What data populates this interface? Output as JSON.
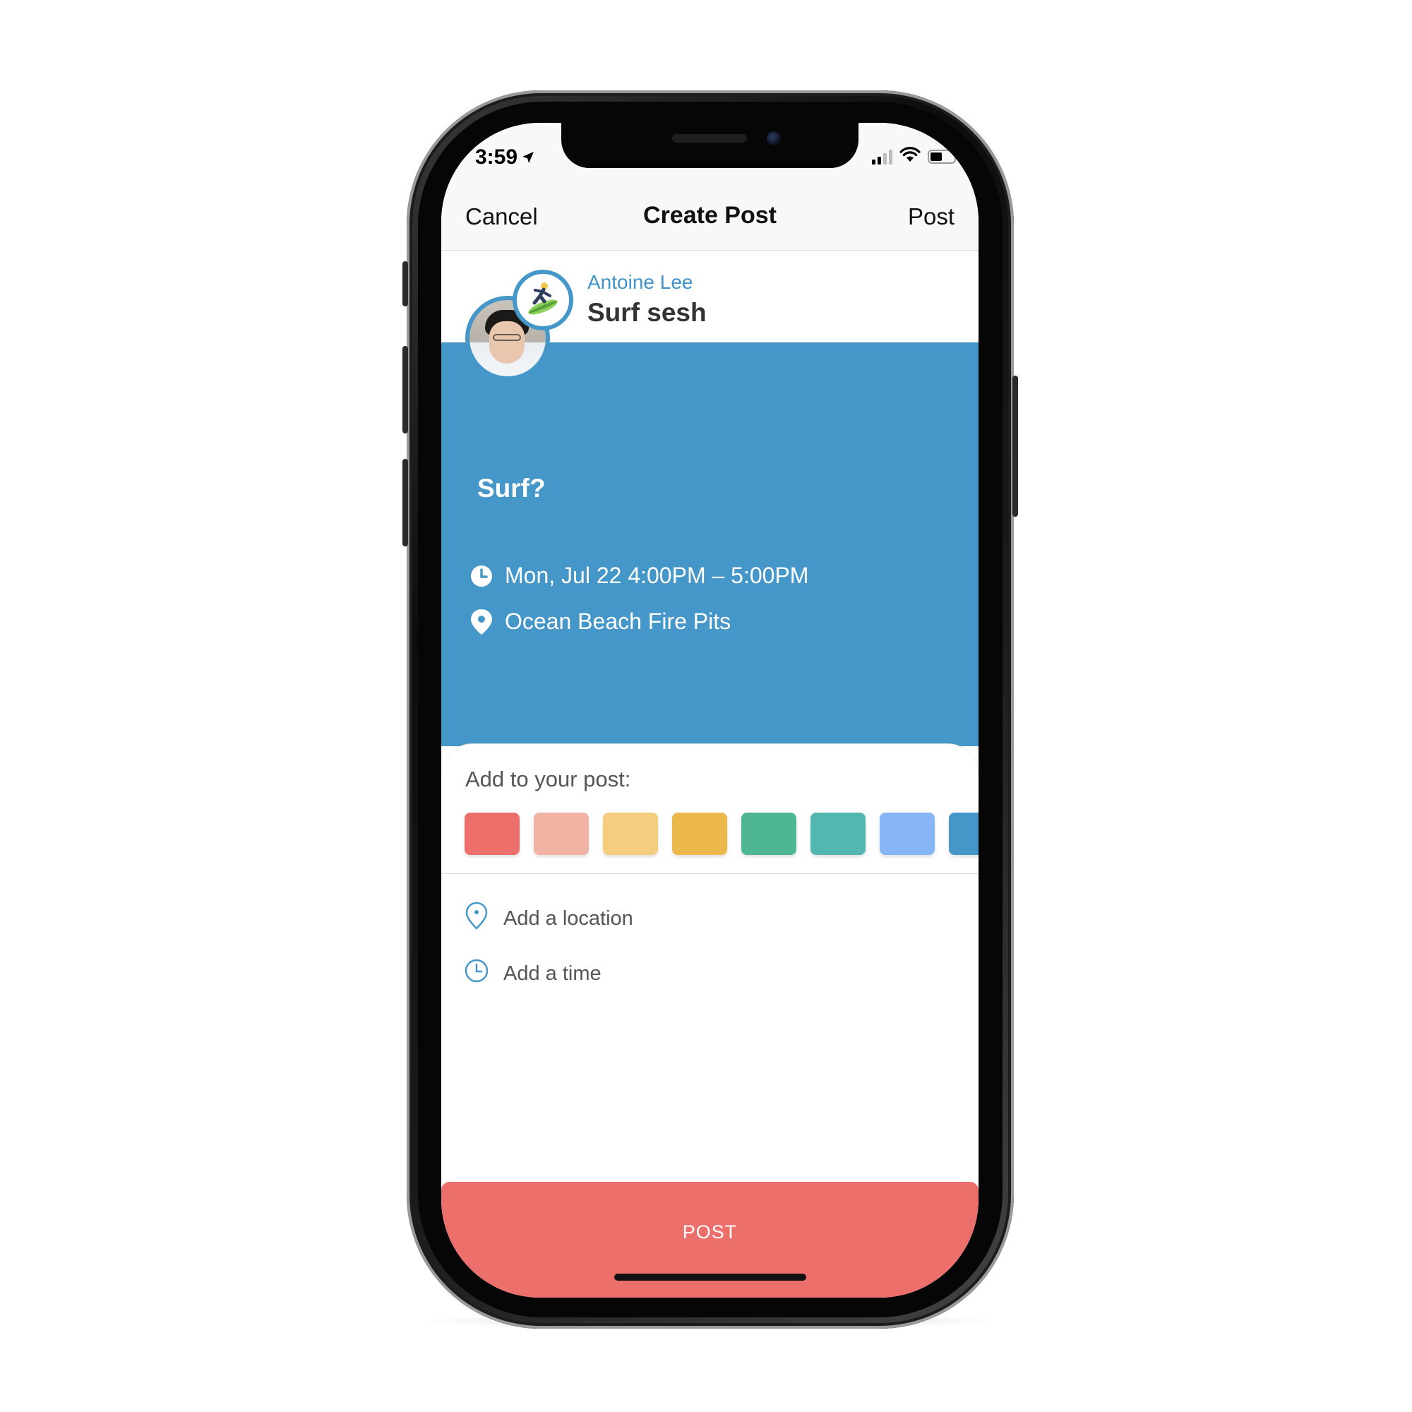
{
  "status_bar": {
    "time": "3:59",
    "location_icon": "location-arrow-icon",
    "signal_icon": "cellular-signal-icon",
    "wifi_icon": "wifi-icon",
    "battery_icon": "battery-icon",
    "battery_level": 0.5
  },
  "nav": {
    "cancel_label": "Cancel",
    "title": "Create Post",
    "post_label": "Post"
  },
  "post": {
    "author": "Antoine Lee",
    "title": "Surf sesh",
    "activity_icon": "surfer-emoji-icon",
    "question": "Surf?",
    "time_text": "Mon, Jul 22 4:00PM – 5:00PM",
    "location_text": "Ocean Beach Fire Pits",
    "card_color": "#4697c9"
  },
  "sheet": {
    "label": "Add to your post:",
    "swatches": [
      "#ec6f6b",
      "#f1b3a4",
      "#f5cd7e",
      "#ecb74b",
      "#4fb694",
      "#52b6b1",
      "#86b6f6",
      "#4697c9"
    ],
    "add_location": "Add a location",
    "add_time": "Add a time"
  },
  "footer": {
    "post_button": "POST",
    "button_color": "#ec6f6b"
  }
}
